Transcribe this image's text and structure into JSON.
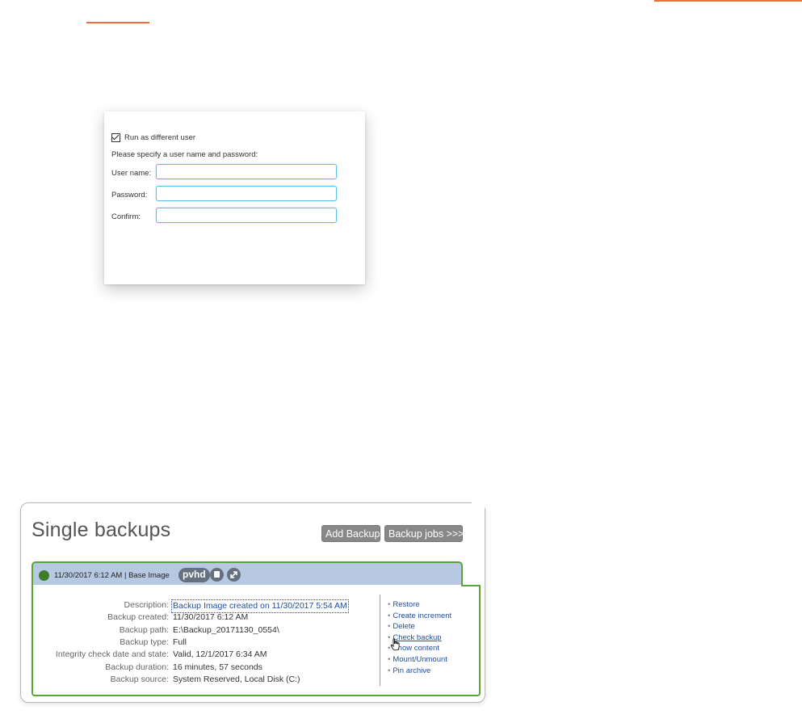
{
  "colors": {
    "accent": "#f26b3a",
    "card_border": "#5aa33b",
    "card_header_bg": "#b6c8e2",
    "status_ok": "#3c7d2a",
    "link": "#1f4e9a",
    "button_bg": "#888888",
    "input_border": "#5fbfea"
  },
  "run_dialog": {
    "run_as_label": "Run as different user",
    "run_as_checked": true,
    "hint": "Please specify a user name and password:",
    "fields": [
      {
        "label": "User name:",
        "value": ""
      },
      {
        "label": "Password:",
        "value": ""
      },
      {
        "label": "Confirm:",
        "value": ""
      }
    ]
  },
  "backups": {
    "title": "Single backups",
    "add_backup_label": "Add Backup",
    "backup_jobs_label": "Backup jobs >>>",
    "card": {
      "status_icon": "status-dot-green",
      "header_text": "11/30/2017 6:12 AM | Base Image",
      "badge": "pvhd",
      "header_icons": [
        "disk-icon",
        "expand-icon"
      ],
      "details": [
        {
          "label": "Description:",
          "value": "Backup Image created on 11/30/2017 5:54 AM"
        },
        {
          "label": "Backup created:",
          "value": "11/30/2017 6:12 AM"
        },
        {
          "label": "Backup path:",
          "value": "E:\\Backup_20171130_0554\\"
        },
        {
          "label": "Backup type:",
          "value": "Full"
        },
        {
          "label": "Integrity check date and state:",
          "value": "Valid, 12/1/2017 6:34 AM"
        },
        {
          "label": "Backup duration:",
          "value": "16 minutes, 57 seconds"
        },
        {
          "label": "Backup source:",
          "value": "System Reserved, Local Disk (C:)"
        }
      ],
      "actions": [
        "Restore",
        "Create increment",
        "Delete",
        "Check backup",
        "Show content",
        "Mount/Unmount",
        "Pin archive"
      ],
      "hovered_action": "Check backup"
    }
  }
}
